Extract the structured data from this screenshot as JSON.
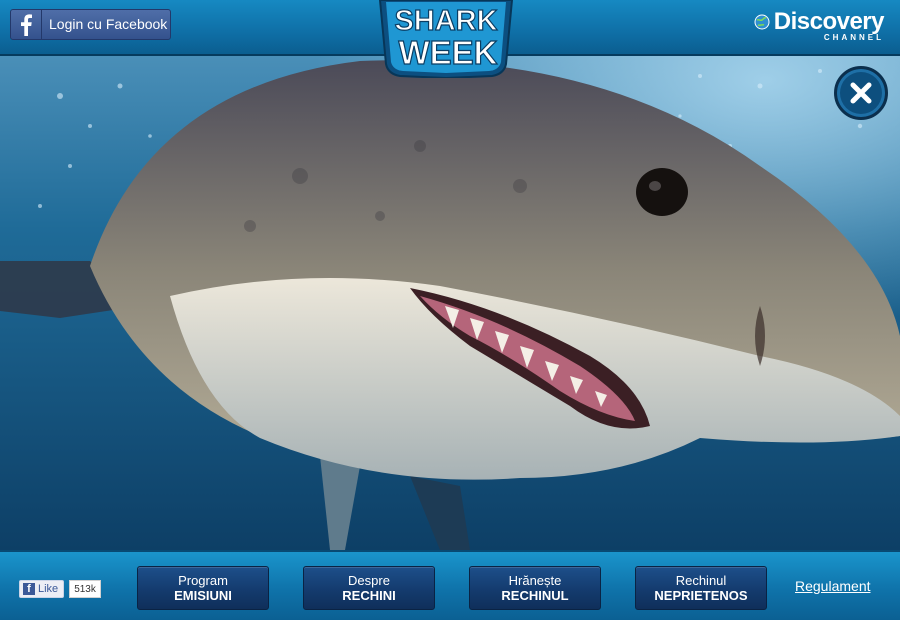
{
  "header": {
    "facebook_login_label": "Login cu Facebook",
    "logo": {
      "line1": "SHARK",
      "line2": "WEEK"
    },
    "brand": {
      "name": "Discovery",
      "sub": "CHANNEL"
    }
  },
  "hero": {
    "icon": "close-icon"
  },
  "footer": {
    "like": {
      "label": "Like",
      "count": "513k"
    },
    "nav": [
      {
        "line1": "Program",
        "line2": "EMISIUNI"
      },
      {
        "line1": "Despre",
        "line2": "RECHINI"
      },
      {
        "line1": "Hrănește",
        "line2": "RECHINUL"
      },
      {
        "line1": "Rechinul",
        "line2": "NEPRIETENOS"
      }
    ],
    "rules_label": "Regulament"
  },
  "colors": {
    "bar_blue": "#0f73aa",
    "button_navy": "#143b6e",
    "facebook_blue": "#3b5998",
    "logo_fill": "#1f97d3"
  }
}
